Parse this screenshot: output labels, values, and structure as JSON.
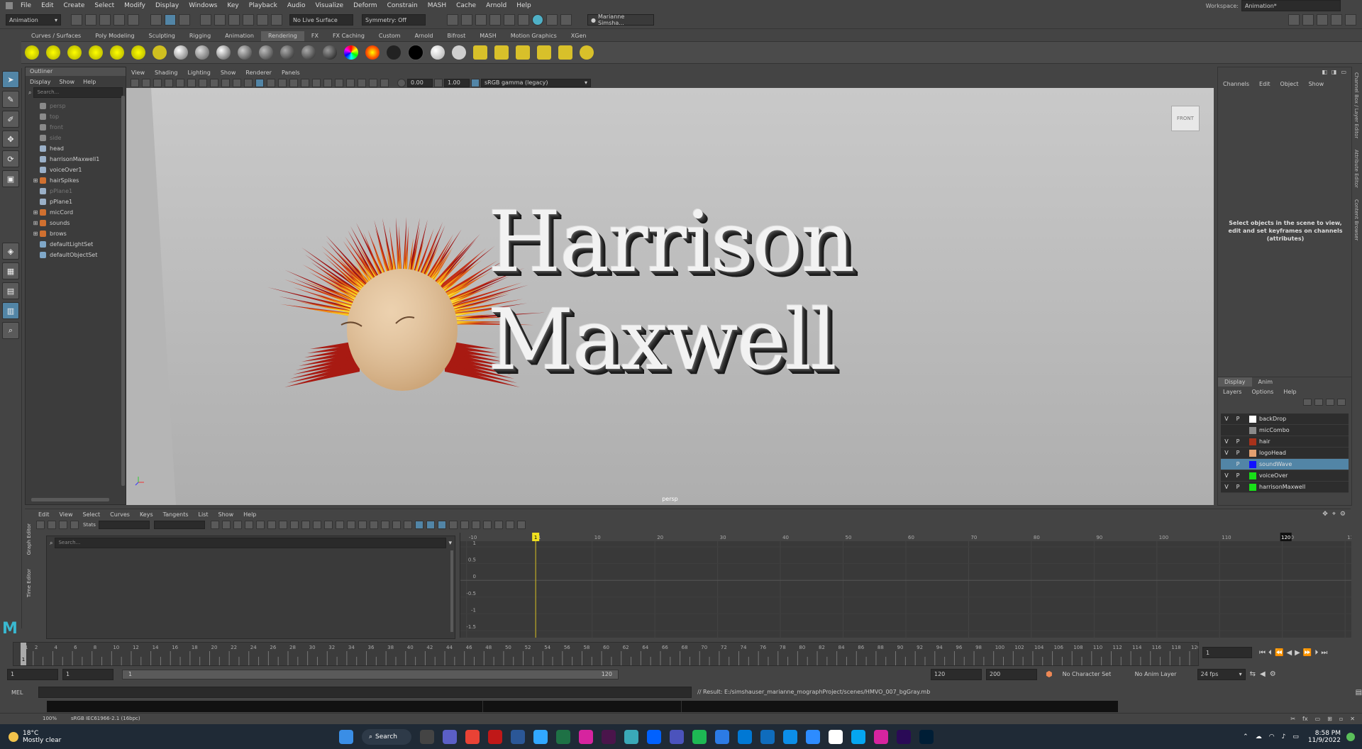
{
  "menubar": {
    "items": [
      "File",
      "Edit",
      "Create",
      "Select",
      "Modify",
      "Display",
      "Windows",
      "Key",
      "Playback",
      "Audio",
      "Visualize",
      "Deform",
      "Constrain",
      "MASH",
      "Cache",
      "Arnold",
      "Help"
    ],
    "workspace_label": "Workspace:",
    "workspace_value": "Animation*"
  },
  "statusline": {
    "mode": "Animation",
    "live_surface": "No Live Surface",
    "symmetry": "Symmetry: Off",
    "user": "Marianne Simsha..."
  },
  "shelf_tabs": [
    "Curves / Surfaces",
    "Poly Modeling",
    "Sculpting",
    "Rigging",
    "Animation",
    "Rendering",
    "FX",
    "FX Caching",
    "Custom",
    "Arnold",
    "Bifrost",
    "MASH",
    "Motion Graphics",
    "XGen"
  ],
  "shelf_active": "Rendering",
  "outliner": {
    "title": "Outliner",
    "menus": [
      "Display",
      "Show",
      "Help"
    ],
    "search_placeholder": "Search...",
    "items": [
      {
        "label": "persp",
        "icon": "camera-icon",
        "dim": true,
        "expand": false
      },
      {
        "label": "top",
        "icon": "camera-icon",
        "dim": true,
        "expand": false
      },
      {
        "label": "front",
        "icon": "camera-icon",
        "dim": true,
        "expand": false
      },
      {
        "label": "side",
        "icon": "camera-icon",
        "dim": true,
        "expand": false
      },
      {
        "label": "head",
        "icon": "mesh-icon",
        "dim": false,
        "expand": false
      },
      {
        "label": "harrisonMaxwell1",
        "icon": "mesh-icon",
        "dim": false,
        "expand": false
      },
      {
        "label": "voiceOver1",
        "icon": "mesh-icon",
        "dim": false,
        "expand": false
      },
      {
        "label": "hairSpikes",
        "icon": "group-icon",
        "dim": false,
        "expand": true
      },
      {
        "label": "pPlane1",
        "icon": "mesh-icon",
        "dim": true,
        "expand": false
      },
      {
        "label": "pPlane1",
        "icon": "mesh-icon",
        "dim": false,
        "expand": false
      },
      {
        "label": "micCord",
        "icon": "group-icon",
        "dim": false,
        "expand": true
      },
      {
        "label": "sounds",
        "icon": "group-icon",
        "dim": false,
        "expand": true
      },
      {
        "label": "brows",
        "icon": "group-icon",
        "dim": false,
        "expand": true
      },
      {
        "label": "defaultLightSet",
        "icon": "set-icon",
        "dim": false,
        "expand": false
      },
      {
        "label": "defaultObjectSet",
        "icon": "set-icon",
        "dim": false,
        "expand": false
      }
    ]
  },
  "viewport": {
    "menus": [
      "View",
      "Shading",
      "Lighting",
      "Show",
      "Renderer",
      "Panels"
    ],
    "exposure": "0.00",
    "gamma": "1.00",
    "colorspace": "sRGB gamma (legacy)",
    "logo_text": "Harrison Maxwell",
    "camera_label": "persp",
    "viewcube": "FRONT"
  },
  "channelbox": {
    "menus": [
      "Channels",
      "Edit",
      "Object",
      "Show"
    ],
    "message": "Select objects in the scene to view, edit and set keyframes on channels (attributes)",
    "side_tabs": [
      "Channel Box / Layer Editor",
      "Attribute Editor",
      "Content Browser"
    ]
  },
  "layers": {
    "tabs": [
      "Display",
      "Anim"
    ],
    "menus": [
      "Layers",
      "Options",
      "Help"
    ],
    "items": [
      {
        "v": "V",
        "p": "P",
        "color": "#ffffff",
        "name": "backDrop",
        "selected": false
      },
      {
        "v": "",
        "p": "",
        "color": "#8a8a8a",
        "name": "micCombo",
        "selected": false
      },
      {
        "v": "V",
        "p": "P",
        "color": "#a8321b",
        "name": "hair",
        "selected": false
      },
      {
        "v": "V",
        "p": "P",
        "color": "#e3a070",
        "name": "logoHead",
        "selected": false
      },
      {
        "v": "",
        "p": "P",
        "color": "#1010ff",
        "name": "soundWave",
        "selected": true
      },
      {
        "v": "V",
        "p": "P",
        "color": "#18e018",
        "name": "voiceOver",
        "selected": false
      },
      {
        "v": "V",
        "p": "P",
        "color": "#18e018",
        "name": "harrisonMaxwell",
        "selected": false
      }
    ]
  },
  "graph_editor": {
    "menus": [
      "Edit",
      "View",
      "Select",
      "Curves",
      "Keys",
      "Tangents",
      "List",
      "Show",
      "Help"
    ],
    "stats_label": "Stats",
    "search_placeholder": "Search...",
    "side_tabs": [
      "Graph Editor",
      "Time Editor"
    ],
    "x_ticks": [
      "-10",
      "1",
      "10",
      "20",
      "30",
      "40",
      "50",
      "60",
      "70",
      "80",
      "90",
      "100",
      "110",
      "120",
      "130"
    ],
    "y_ticks": [
      "1",
      "0.5",
      "0",
      "-0.5",
      "-1",
      "-1.5"
    ],
    "current_frame": "1",
    "end_marker": "120"
  },
  "timeline": {
    "ticks": [
      "1",
      "2",
      "4",
      "6",
      "8",
      "10",
      "12",
      "14",
      "16",
      "18",
      "20",
      "22",
      "24",
      "26",
      "28",
      "30",
      "32",
      "34",
      "36",
      "38",
      "40",
      "42",
      "44",
      "46",
      "48",
      "50",
      "52",
      "54",
      "56",
      "58",
      "60",
      "62",
      "64",
      "66",
      "68",
      "70",
      "72",
      "74",
      "76",
      "78",
      "80",
      "82",
      "84",
      "86",
      "88",
      "90",
      "92",
      "94",
      "96",
      "98",
      "100",
      "102",
      "104",
      "106",
      "108",
      "110",
      "112",
      "114",
      "116",
      "118",
      "120"
    ],
    "current_frame": "1"
  },
  "range": {
    "start": "1",
    "start2": "1",
    "slider_start": "1",
    "slider_end": "120",
    "end": "120",
    "end2": "200",
    "character_set": "No Character Set",
    "anim_layer": "No Anim Layer",
    "fps": "24 fps"
  },
  "mel": {
    "label": "MEL",
    "result": "// Result: E:/simshauser_marianne_mographProject/scenes/HMVO_007_bgGray.mb"
  },
  "helpline": {
    "zoom": "100%",
    "colorspace": "sRGB IEC61966-2.1 (16bpc)"
  },
  "taskbar": {
    "weather_temp": "18°C",
    "weather_desc": "Mostly clear",
    "search_label": "Search",
    "time": "8:58 PM",
    "date": "11/9/2022"
  }
}
